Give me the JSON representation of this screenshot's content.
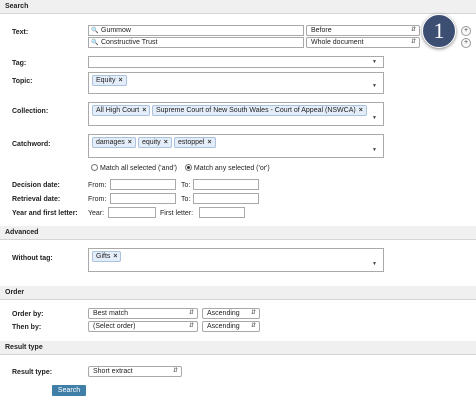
{
  "sections": {
    "search": "Search",
    "advanced": "Advanced",
    "order": "Order",
    "result_type": "Result type"
  },
  "labels": {
    "text": "Text:",
    "tag": "Tag:",
    "topic": "Topic:",
    "collection": "Collection:",
    "catchword": "Catchword:",
    "decision_date": "Decision date:",
    "retrieval_date": "Retrieval date:",
    "year_first_letter": "Year and first letter:",
    "without_tag": "Without tag:",
    "order_by": "Order by:",
    "then_by": "Then by:",
    "result_type": "Result type:"
  },
  "text_rows": [
    {
      "value": "Gummow",
      "scope": "Before"
    },
    {
      "value": "Constructive Trust",
      "scope": "Whole document"
    }
  ],
  "topic_tags": [
    "Equity"
  ],
  "collection_tags": [
    "All High Court",
    "Supreme Court of New South Wales - Court of Appeal (NSWCA)"
  ],
  "catchword_tags": [
    "damages",
    "equity",
    "estoppel"
  ],
  "match": {
    "all_label": "Match all selected ('and')",
    "any_label": "Match any selected ('or')",
    "selected": "any"
  },
  "dates": {
    "from": "From:",
    "to": "To:",
    "year": "Year:",
    "first_letter": "First letter:"
  },
  "without_tag_tags": [
    "Gifts"
  ],
  "order": {
    "order_by": "Best match",
    "order_by_dir": "Ascending",
    "then_by": "(Select order)",
    "then_by_dir": "Ascending"
  },
  "result_type_value": "Short extract",
  "search_button": "Search",
  "badge_number": "1",
  "icons": {
    "search": "magnifier-icon",
    "remove": "x-icon",
    "add": "plus-icon",
    "dropdown": "chevron-down-icon"
  }
}
